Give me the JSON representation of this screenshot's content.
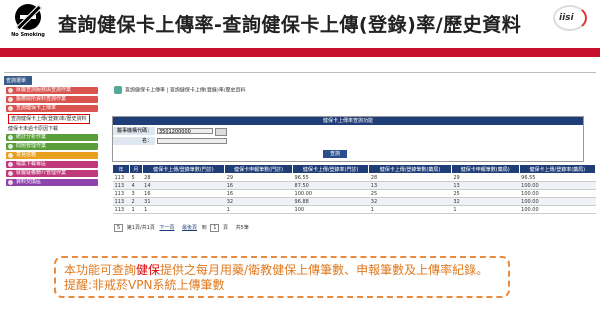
{
  "header": {
    "no_smoking_label": "No Smoking",
    "title": "查詢健保卡上傳率-查詢健保卡上傳(登錄)率/歷史資料",
    "logo_text": "iisi"
  },
  "sidebar": {
    "head": "查詢選單",
    "items": [
      {
        "label": "就醫查詢服務與查詢作業",
        "color": "#d9534f"
      },
      {
        "label": "醫療院所資料查詢作業",
        "color": "#d9534f"
      },
      {
        "label": "查詢健保卡上傳率",
        "color": "#d9534f"
      }
    ],
    "sub_items": [
      "查詢健保卡上傳(登錄)率/歷史資料",
      "健保卡未過卡原因下載"
    ],
    "items2": [
      {
        "label": "統計分析作業",
        "color": "#5a9e3a"
      },
      {
        "label": "問題管理作業",
        "color": "#5a9e3a"
      },
      {
        "label": "意見信箱",
        "color": "#e8a020"
      },
      {
        "label": "檔案下載專區",
        "color": "#c0397a"
      },
      {
        "label": "就醫疑義轉介管理作業",
        "color": "#c0397a"
      },
      {
        "label": "資料交換區",
        "color": "#8e44ad"
      }
    ]
  },
  "main": {
    "crumb": "查詢健保卡上傳率 | 查詢健保卡上傳(登錄)率/歷史資料",
    "panel_title": "健保卡上傳率查詢功能",
    "label_code": "醫事機構代碼：",
    "code_value": "3501200000",
    "label_name": "名：",
    "query_btn": "查詢",
    "columns": [
      "年",
      "月",
      "健保卡上傳/登錄筆數(門診)",
      "健保卡申報筆數(門診)",
      "健保卡上傳/登錄率(門診)",
      "健保卡上傳/登錄筆數(藥局)",
      "健保卡申報筆數(藥局)",
      "健保卡上傳/登錄率(藥局)"
    ],
    "rows": [
      [
        "113",
        "5",
        "28",
        "29",
        "96.55",
        "28",
        "29",
        "96.55"
      ],
      [
        "113",
        "4",
        "14",
        "16",
        "87.50",
        "13",
        "13",
        "100.00"
      ],
      [
        "113",
        "3",
        "16",
        "16",
        "100.00",
        "25",
        "25",
        "100.00"
      ],
      [
        "113",
        "2",
        "31",
        "32",
        "96.88",
        "32",
        "32",
        "100.00"
      ],
      [
        "113",
        "1",
        "1",
        "1",
        "100",
        "1",
        "1",
        "100.00"
      ]
    ],
    "pager": {
      "per_page": "5",
      "page_info": "第1頁/共1頁",
      "next": "下一頁",
      "last": "最後頁",
      "goto": "到",
      "page": "1",
      "suffix": "頁",
      "total": "共5筆"
    }
  },
  "note": {
    "line1_a": "本功能可查詢",
    "line1_b": "健保",
    "line1_c": "提供之每月用藥/衛教健保上傳筆數、申報筆數及上傳率紀錄。",
    "line2": "提醒:非戒菸VPN系統上傳筆數"
  }
}
